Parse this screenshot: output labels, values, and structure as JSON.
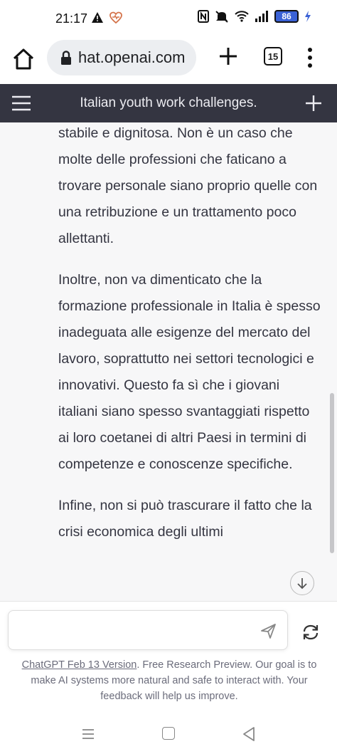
{
  "status_bar": {
    "time": "21:17",
    "battery": "86",
    "icons": [
      "warning-icon",
      "heart-icon",
      "nfc-icon",
      "mute-icon",
      "wifi-icon",
      "signal-icon",
      "battery-icon",
      "charging-icon"
    ]
  },
  "browser": {
    "url": "hat.openai.com",
    "tab_count": "15"
  },
  "chat": {
    "title": "Italian youth work challenges.",
    "paragraphs": [
      "stabile e dignitosa. Non è un caso che molte delle professioni che faticano a trovare personale siano proprio quelle con una retribuzione e un trattamento poco allettanti.",
      "Inoltre, non va dimenticato che la formazione professionale in Italia è spesso inadeguata alle esigenze del mercato del lavoro, soprattutto nei settori tecnologici e innovativi. Questo fa sì che i giovani italiani siano spesso svantaggiati rispetto ai loro coetanei di altri Paesi in termini di competenze e conoscenze specifiche.",
      "Infine, non si può trascurare il fatto che la crisi economica degli ultimi"
    ]
  },
  "input": {
    "placeholder": ""
  },
  "footer": {
    "version_link": "ChatGPT Feb 13 Version",
    "note": ". Free Research Preview. Our goal is to make AI systems more natural and safe to interact with. Your feedback will help us improve."
  },
  "colors": {
    "header_bg": "#343541",
    "content_bg": "#f7f7f8",
    "text": "#343541",
    "battery": "#3b62d6"
  }
}
